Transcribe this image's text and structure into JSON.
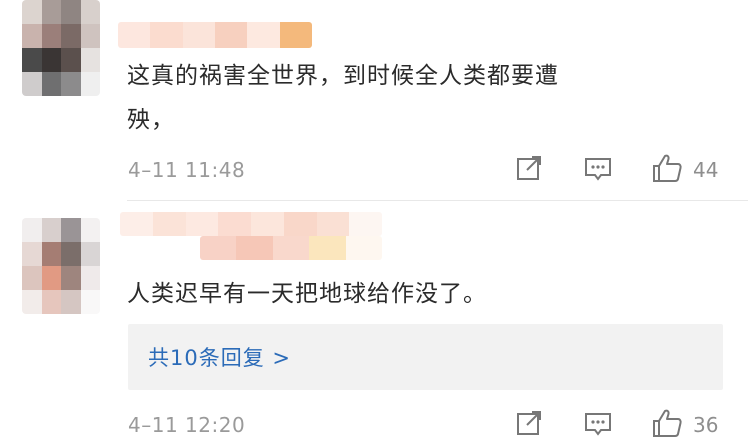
{
  "comments": [
    {
      "text_line1": "这真的祸害全世界，到时候全人类都要遭",
      "text_line2": "殃，",
      "time": "4–11 11:48",
      "likes": "44",
      "icons": [
        "share-icon",
        "comment-icon",
        "like-icon"
      ]
    },
    {
      "text_line1": "人类迟早有一天把地球给作没了。",
      "reply_link": "共10条回复 >",
      "time": "4–11 12:20",
      "likes": "36",
      "icons": [
        "share-icon",
        "comment-icon",
        "like-icon"
      ]
    }
  ],
  "colors": {
    "link": "#2b6bb8",
    "meta": "#9a9a9a",
    "reply_bg": "#f2f2f2"
  }
}
